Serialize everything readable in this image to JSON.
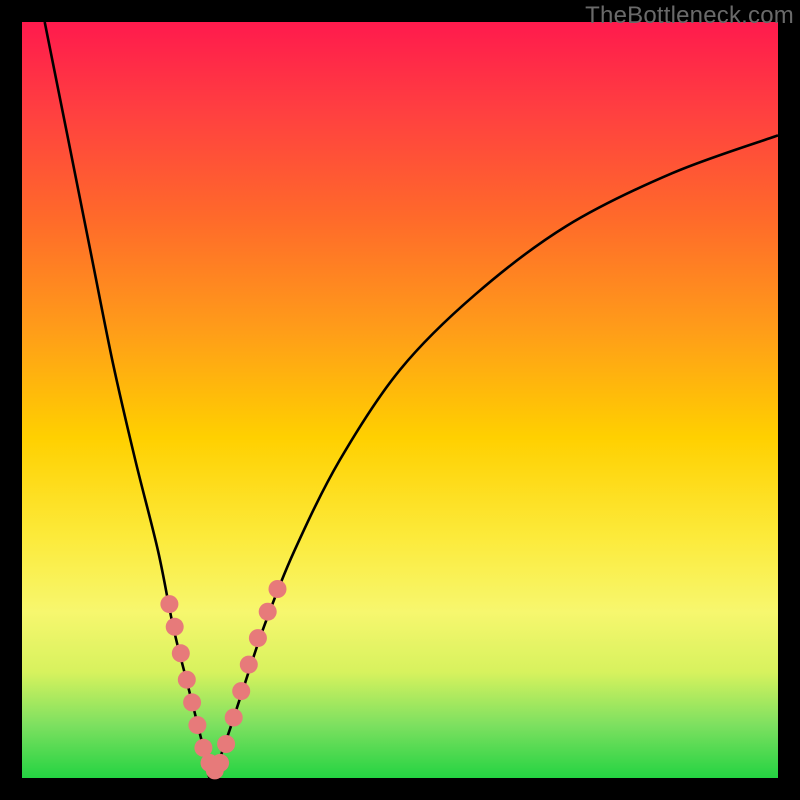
{
  "watermark": "TheBottleneck.com",
  "chart_data": {
    "type": "line",
    "title": "",
    "xlabel": "",
    "ylabel": "",
    "xlim": [
      0,
      100
    ],
    "ylim": [
      0,
      100
    ],
    "curve": {
      "description": "V-shaped bottleneck curve; y is bottleneck percentage, minimum near x≈25",
      "left_branch_x": [
        3,
        6,
        9,
        12,
        15,
        18,
        20,
        22,
        24,
        25
      ],
      "left_branch_y": [
        100,
        85,
        70,
        55,
        42,
        30,
        20,
        12,
        4,
        0
      ],
      "right_branch_x": [
        25,
        27,
        29,
        32,
        36,
        42,
        50,
        60,
        72,
        86,
        100
      ],
      "right_branch_y": [
        0,
        5,
        11,
        20,
        30,
        42,
        54,
        64,
        73,
        80,
        85
      ]
    },
    "series": [
      {
        "name": "sample-points",
        "color": "#e77a7a",
        "x": [
          19.5,
          20.2,
          21.0,
          21.8,
          22.5,
          23.2,
          24.0,
          24.8,
          25.5,
          26.2,
          27.0,
          28.0,
          29.0,
          30.0,
          31.2,
          32.5,
          33.8
        ],
        "y": [
          23.0,
          20.0,
          16.5,
          13.0,
          10.0,
          7.0,
          4.0,
          2.0,
          1.0,
          2.0,
          4.5,
          8.0,
          11.5,
          15.0,
          18.5,
          22.0,
          25.0
        ]
      }
    ]
  }
}
